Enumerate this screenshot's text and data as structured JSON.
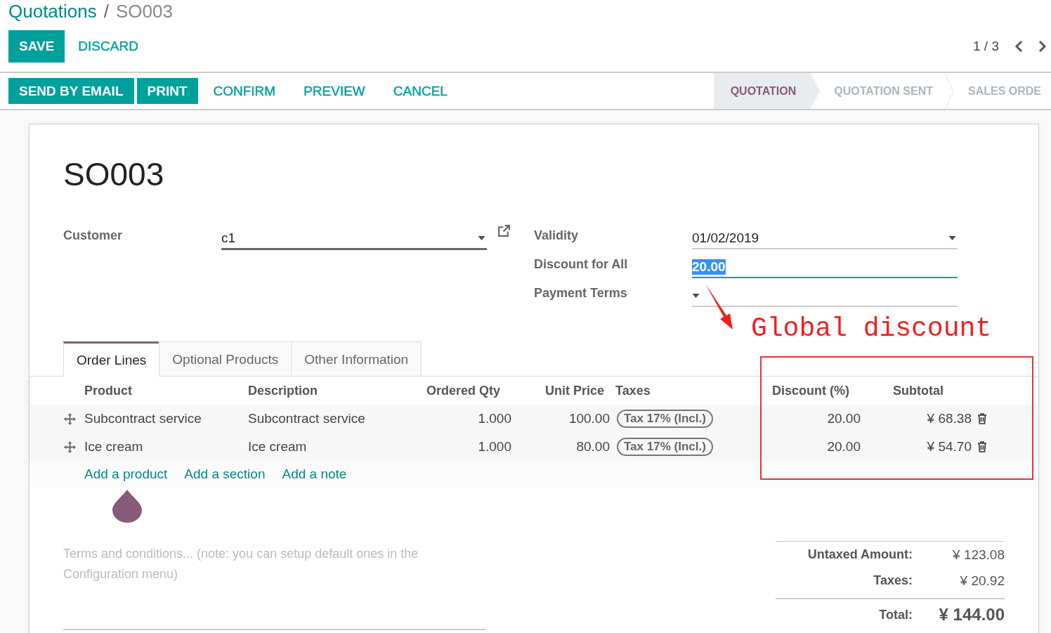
{
  "breadcrumb": {
    "parent": "Quotations",
    "separator": "/",
    "current": "SO003"
  },
  "action_buttons": [
    {
      "label": "SAVE",
      "primary": true
    },
    {
      "label": "DISCARD",
      "primary": false
    }
  ],
  "pager": "1 / 3",
  "status_buttons": [
    {
      "label": "SEND BY EMAIL",
      "primary": true
    },
    {
      "label": "PRINT",
      "primary": true
    },
    {
      "label": "CONFIRM",
      "primary": false
    },
    {
      "label": "PREVIEW",
      "primary": false
    },
    {
      "label": "CANCEL",
      "primary": false
    }
  ],
  "stages": [
    {
      "label": "QUOTATION",
      "selected": true
    },
    {
      "label": "QUOTATION SENT",
      "selected": false
    },
    {
      "label": "SALES ORDE",
      "selected": false
    }
  ],
  "title": "SO003",
  "left_fields": [
    {
      "label": "Customer",
      "value": "c1",
      "kind": "dropdown",
      "focused": false,
      "external_link": true
    }
  ],
  "right_fields": [
    {
      "label": "Validity",
      "value": "01/02/2019",
      "kind": "dropdown",
      "focused": false
    },
    {
      "label": "Discount for All",
      "value": "20.00",
      "kind": "text",
      "focused": true
    },
    {
      "label": "Payment Terms",
      "kind": "dropdown",
      "focused": false
    }
  ],
  "tabs": [
    {
      "label": "Order Lines",
      "selected": true
    },
    {
      "label": "Optional Products",
      "selected": false
    },
    {
      "label": "Other Information",
      "selected": false
    }
  ],
  "table": {
    "columns": [
      "Product",
      "Description",
      "Ordered Qty",
      "Unit Price",
      "Taxes",
      "Discount (%)",
      "Subtotal"
    ],
    "rows": [
      {
        "product": "Subcontract service",
        "description": "Subcontract service",
        "qty": "1.000",
        "price": "100.00",
        "tax": "Tax 17% (Incl.)",
        "discount": "20.00",
        "subtotal": "¥ 68.38"
      },
      {
        "product": "Ice cream",
        "description": "Ice cream",
        "qty": "1.000",
        "price": "80.00",
        "tax": "Tax 17% (Incl.)",
        "discount": "20.00",
        "subtotal": "¥ 54.70"
      }
    ],
    "add_links": [
      "Add a product",
      "Add a section",
      "Add a note"
    ]
  },
  "terms_placeholder": "Terms and conditions... (note: you can setup default ones in the Configuration menu)",
  "totals": [
    {
      "label": "Untaxed Amount:",
      "value": "¥ 123.08",
      "kind": "normal"
    },
    {
      "label": "Taxes:",
      "value": "¥ 20.92",
      "kind": "normal"
    },
    {
      "label": "Total:",
      "value": "¥ 144.00",
      "kind": "grand"
    }
  ],
  "annotation": {
    "text": "Global discount"
  }
}
